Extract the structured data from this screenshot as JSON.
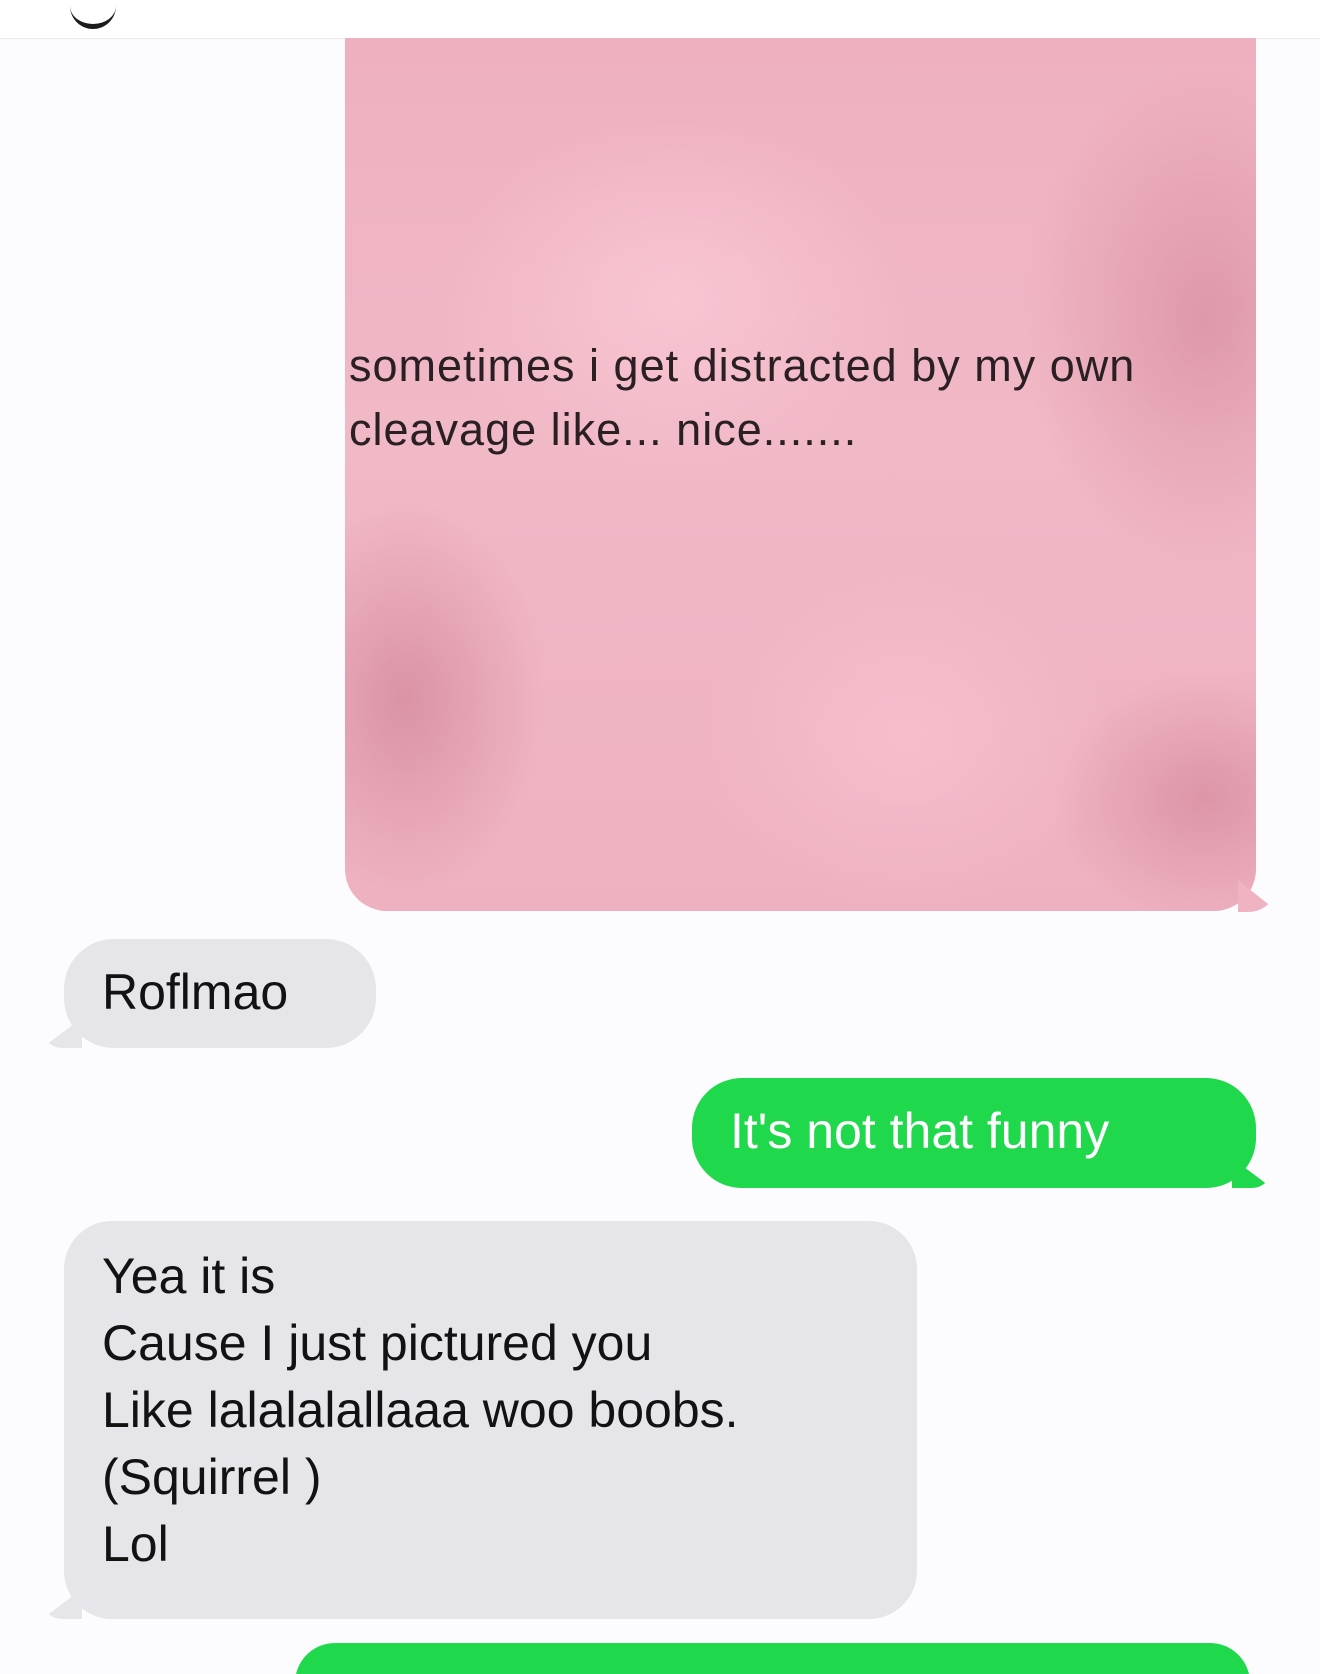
{
  "thread": {
    "image_message": {
      "caption": "sometimes i get distracted by my own\ncleavage like... nice......."
    },
    "messages": [
      {
        "direction": "received",
        "text": "Roflmao"
      },
      {
        "direction": "sent",
        "text": "It's not that funny"
      },
      {
        "direction": "received",
        "text": "Yea it is\nCause I just pictured you\nLike lalalalallaaa woo boobs.\n(Squirrel )\nLol"
      },
      {
        "direction": "sent",
        "text": ""
      }
    ]
  },
  "colors": {
    "received_bubble": "#e5e5ea",
    "sent_bubble": "#1fd84b",
    "image_pink": "#efb3c2"
  }
}
